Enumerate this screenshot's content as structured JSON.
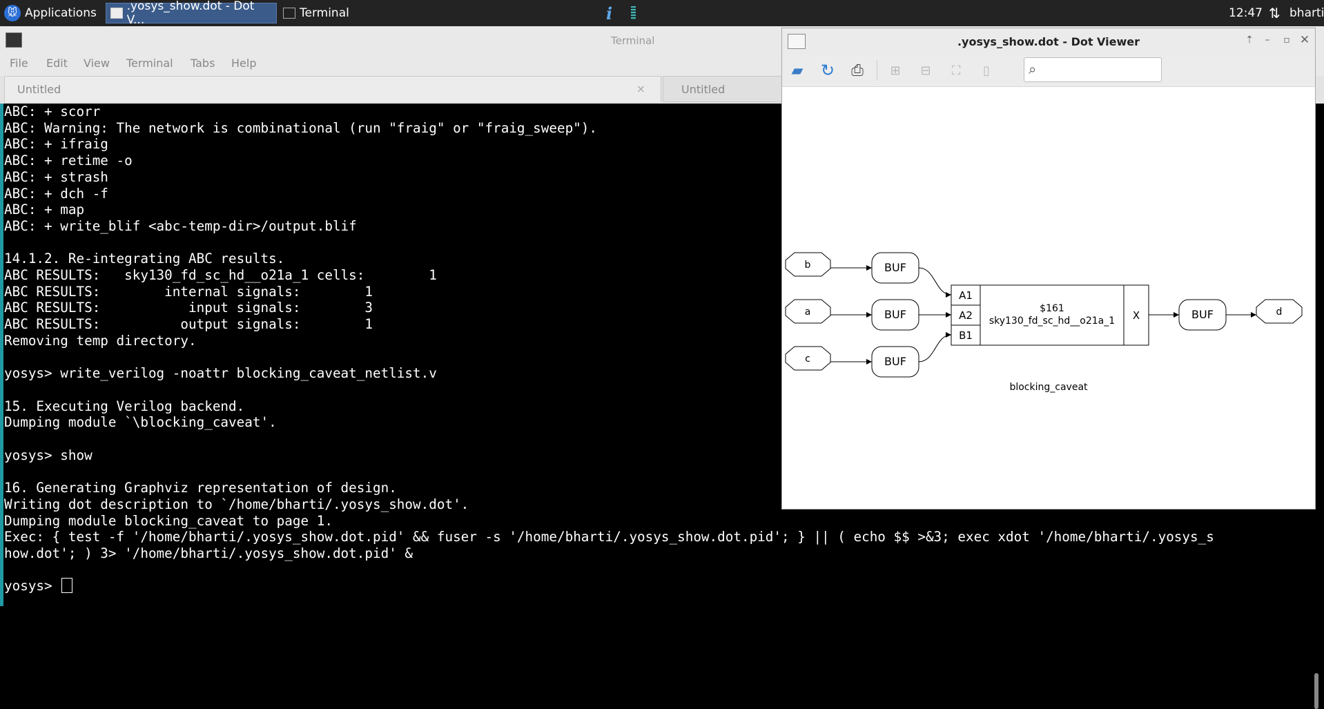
{
  "taskbar": {
    "applications_label": "Applications",
    "tasks": [
      {
        "label": ".yosys_show.dot - Dot V..."
      },
      {
        "label": "Terminal"
      }
    ],
    "info_icon_glyph": "i",
    "clock": "12:47",
    "user": "bharti"
  },
  "terminal": {
    "title": "Terminal",
    "menu": [
      "File",
      "Edit",
      "View",
      "Terminal",
      "Tabs",
      "Help"
    ],
    "tabs": [
      {
        "label": "Untitled",
        "close": "×"
      },
      {
        "label": "Untitled"
      }
    ],
    "lines": [
      "ABC: + scorr",
      "ABC: Warning: The network is combinational (run \"fraig\" or \"fraig_sweep\").",
      "ABC: + ifraig",
      "ABC: + retime -o",
      "ABC: + strash",
      "ABC: + dch -f",
      "ABC: + map",
      "ABC: + write_blif <abc-temp-dir>/output.blif",
      "",
      "14.1.2. Re-integrating ABC results.",
      "ABC RESULTS:   sky130_fd_sc_hd__o21a_1 cells:        1",
      "ABC RESULTS:        internal signals:        1",
      "ABC RESULTS:           input signals:        3",
      "ABC RESULTS:          output signals:        1",
      "Removing temp directory.",
      "",
      "yosys> write_verilog -noattr blocking_caveat_netlist.v",
      "",
      "15. Executing Verilog backend.",
      "Dumping module `\\blocking_caveat'.",
      "",
      "yosys> show",
      "",
      "16. Generating Graphviz representation of design.",
      "Writing dot description to `/home/bharti/.yosys_show.dot'.",
      "Dumping module blocking_caveat to page 1.",
      "Exec: { test -f '/home/bharti/.yosys_show.dot.pid' && fuser -s '/home/bharti/.yosys_show.dot.pid'; } || ( echo $$ >&3; exec xdot '/home/bharti/.yosys_s",
      "how.dot'; ) 3> '/home/bharti/.yosys_show.dot.pid' &",
      ""
    ],
    "prompt": "yosys> "
  },
  "dot_viewer": {
    "title": ".yosys_show.dot - Dot Viewer",
    "toolbar": {
      "icons": [
        "open-icon",
        "reload-icon",
        "print-icon",
        "zoom-in-icon",
        "zoom-out-icon",
        "zoom-fit-icon",
        "zoom-100-icon"
      ]
    },
    "search": {
      "placeholder": "",
      "value": ""
    },
    "graph": {
      "inputs": [
        "b",
        "a",
        "c"
      ],
      "buffer_label": "BUF",
      "cell_ports": [
        "A1",
        "A2",
        "B1"
      ],
      "cell_id": "$161",
      "cell_type": "sky130_fd_sc_hd__o21a_1",
      "cell_output": "X",
      "output": "d",
      "module_label": "blocking_caveat"
    }
  }
}
